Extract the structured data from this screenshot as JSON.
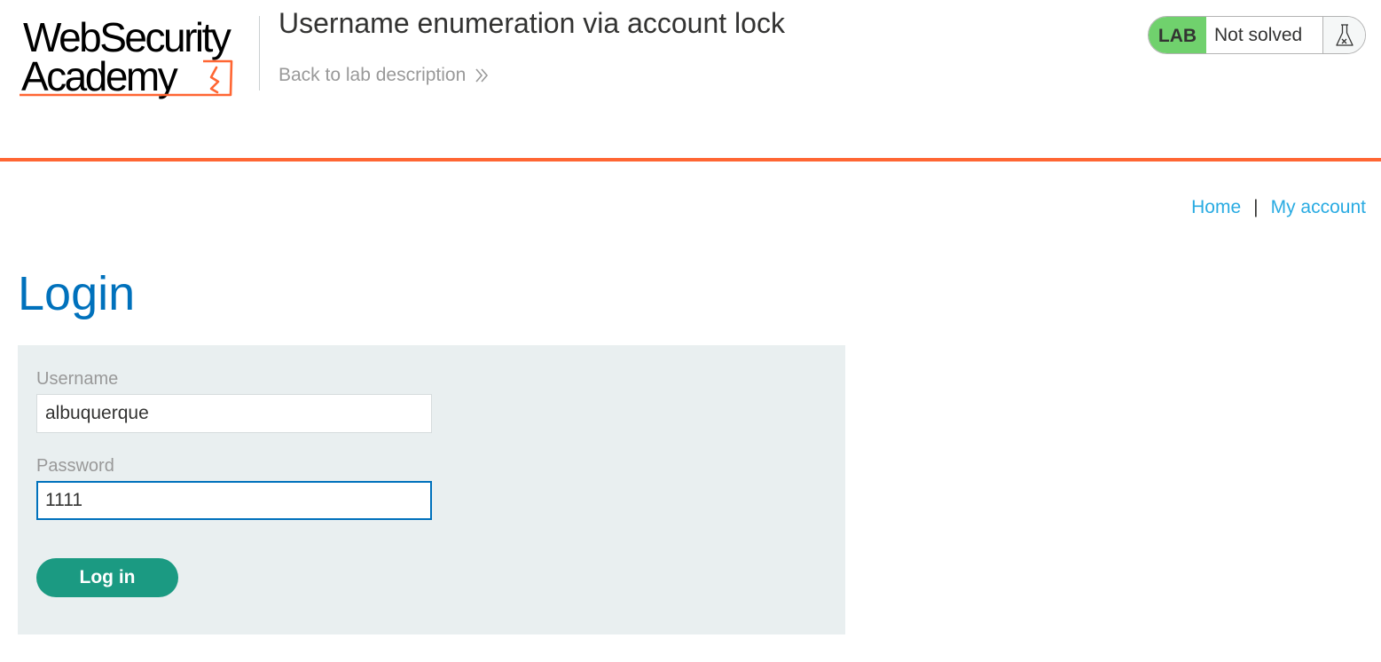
{
  "header": {
    "logo": {
      "line1": "WebSecurity",
      "line2": "Academy"
    },
    "lab_title": "Username enumeration via account lock",
    "back_link": "Back to lab description",
    "status": {
      "badge": "LAB",
      "text": "Not solved",
      "icon": "flask-icon"
    }
  },
  "nav": {
    "home": "Home",
    "separator": "|",
    "account": "My account"
  },
  "page": {
    "heading": "Login"
  },
  "form": {
    "username_label": "Username",
    "username_value": "albuquerque",
    "password_label": "Password",
    "password_value": "1111",
    "submit_label": "Log in"
  },
  "colors": {
    "accent_orange": "#ff6633",
    "heading_blue": "#0071bc",
    "link_blue": "#29abe2",
    "lab_green": "#70d16d",
    "button_green": "#1b9a82",
    "panel_bg": "#e9eff0"
  }
}
